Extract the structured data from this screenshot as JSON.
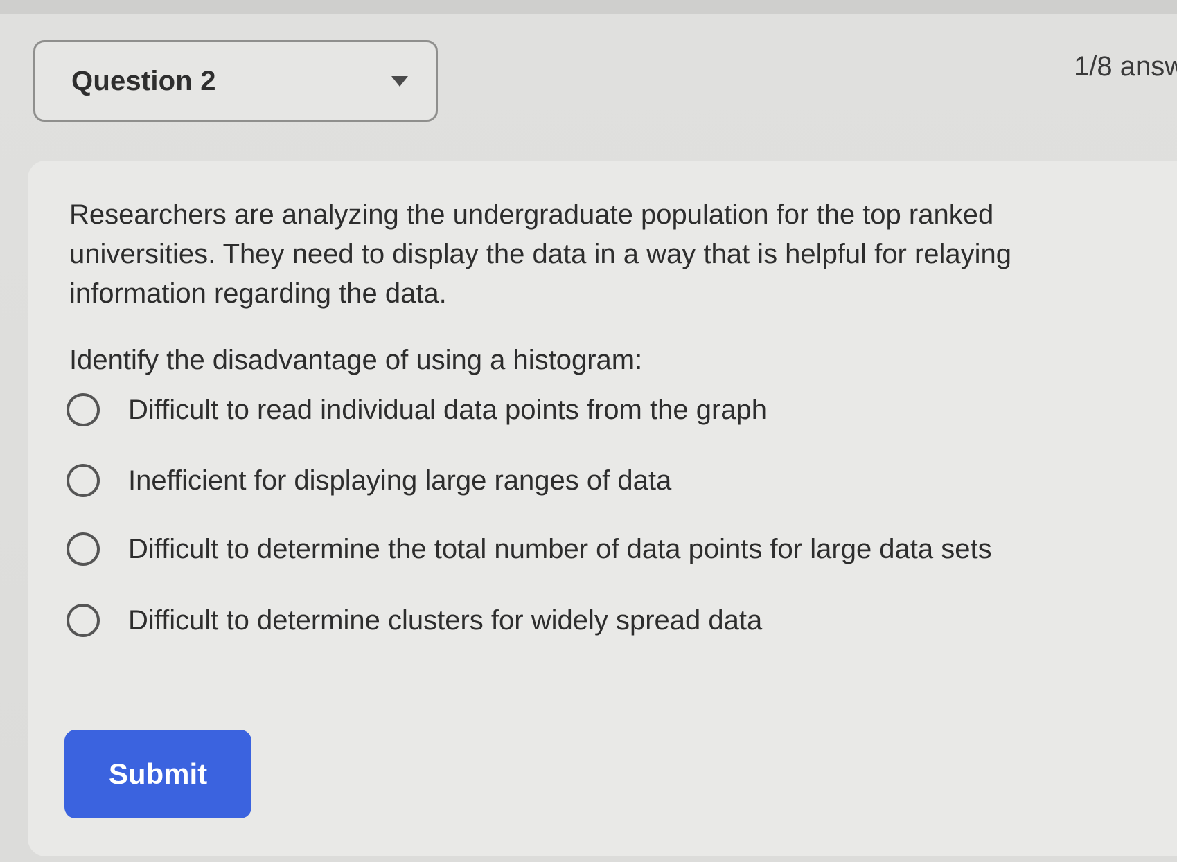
{
  "header": {
    "question_selector_label": "Question 2",
    "answered_status": "1/8 answ"
  },
  "question": {
    "body": "Researchers are analyzing the undergraduate population for the top ranked universities. They need to display the data in a way that is helpful for relaying information regarding the data.",
    "prompt": "Identify the disadvantage of using a histogram:",
    "options": [
      {
        "label": "Difficult to read individual data points from the graph",
        "selected": false
      },
      {
        "label": "Inefficient for displaying large ranges of data",
        "selected": false
      },
      {
        "label": "Difficult to determine the total number of data points for large data sets",
        "selected": false
      },
      {
        "label": "Difficult to determine clusters for widely spread data",
        "selected": false
      }
    ]
  },
  "actions": {
    "submit_label": "Submit"
  },
  "icons": {
    "selector_caret": "chevron-down-icon",
    "option_radio": "radio-unchecked-icon"
  },
  "colors": {
    "submit_button": "#3b63df",
    "card_background": "#e9e9e7",
    "page_background": "#dcdcda"
  }
}
